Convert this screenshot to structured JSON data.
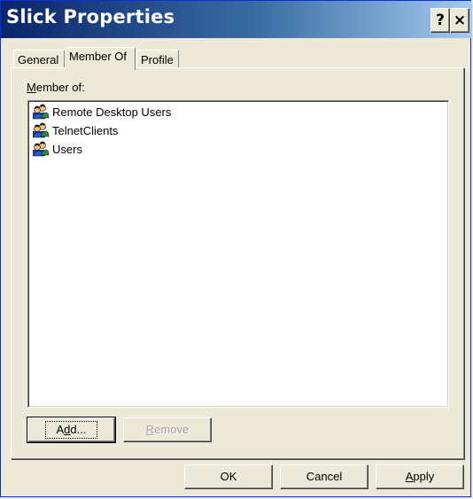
{
  "window": {
    "title": "Slick Properties",
    "help_label": "?",
    "close_label": "×"
  },
  "tabs": [
    {
      "label": "General",
      "active": false
    },
    {
      "label": "Member Of",
      "active": true
    },
    {
      "label": "Profile",
      "active": false
    }
  ],
  "member_of": {
    "label_accel": "M",
    "label_rest": "ember of:",
    "groups": [
      {
        "name": "Remote Desktop Users",
        "icon": "user-group-icon"
      },
      {
        "name": "TelnetClients",
        "icon": "user-group-icon"
      },
      {
        "name": "Users",
        "icon": "user-group-icon"
      }
    ],
    "add_accel": "d",
    "add_pre": "A",
    "add_post": "d...",
    "remove_accel": "R",
    "remove_rest": "emove"
  },
  "footer": {
    "ok_label": "OK",
    "cancel_label": "Cancel",
    "apply_accel": "A",
    "apply_rest": "pply"
  }
}
